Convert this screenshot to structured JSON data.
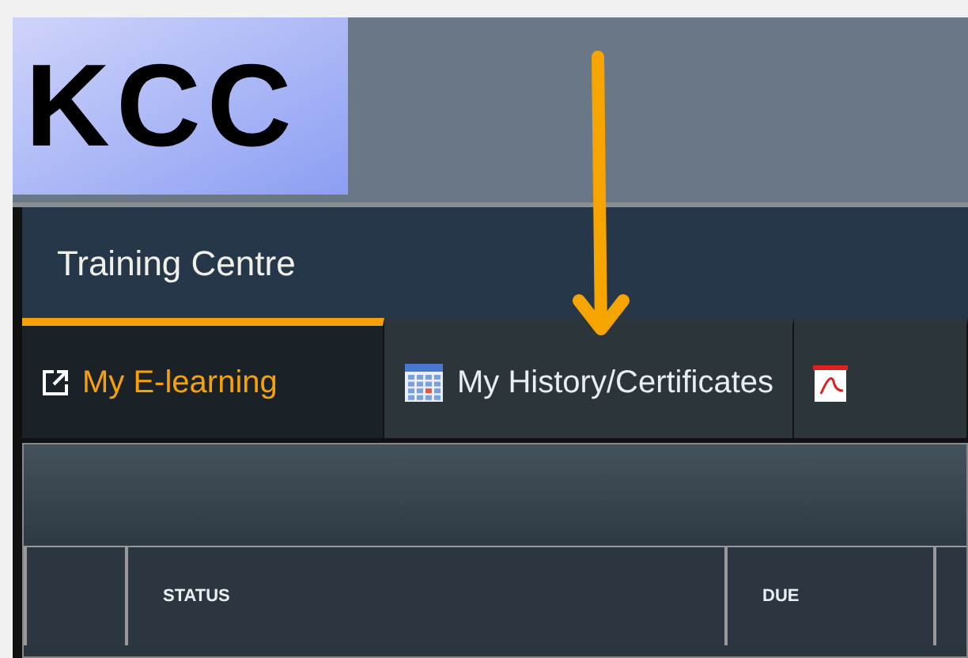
{
  "logo": {
    "text": "KCC"
  },
  "title": "Training Centre",
  "tabs": [
    {
      "label": "My E-learning",
      "kind": "external",
      "selected": true
    },
    {
      "label": "My History/Certificates",
      "kind": "calendar",
      "selected": false
    },
    {
      "kind": "pdf",
      "selected": false
    }
  ],
  "table": {
    "columns": [
      {
        "kind": "blank"
      },
      {
        "kind": "text",
        "label": "STATUS"
      },
      {
        "kind": "text",
        "label": "DUE"
      },
      {
        "kind": "blank"
      }
    ]
  },
  "annotation": {
    "kind": "arrow"
  }
}
